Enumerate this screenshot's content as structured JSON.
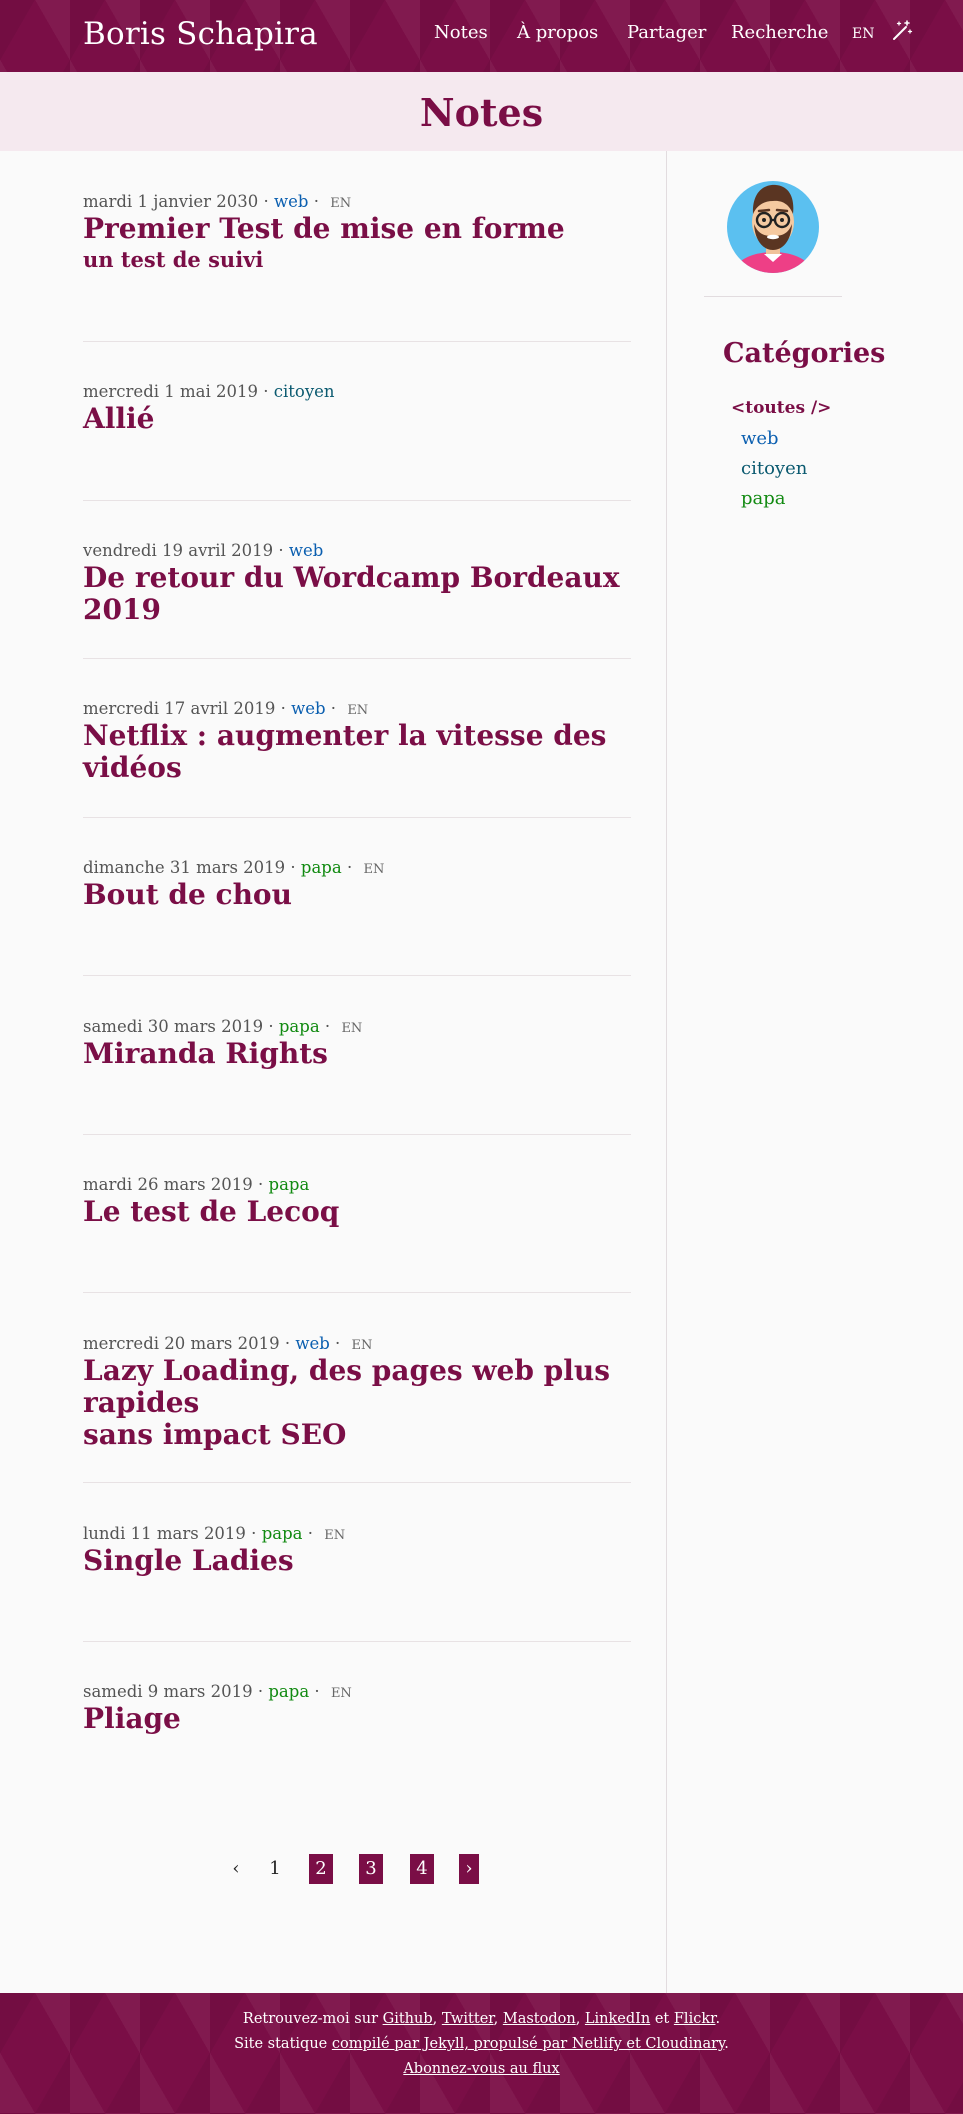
{
  "header": {
    "site_title": "Boris Schapira",
    "nav": [
      "Notes",
      "À propos",
      "Partager",
      "Recherche"
    ],
    "lang_switch": "EN",
    "theme_icon": "magic-wand-icon"
  },
  "page": {
    "title": "Notes"
  },
  "posts": [
    {
      "date": "mardi 1 janvier 2030",
      "category": "web",
      "lang": "EN",
      "title": "Premier Test de mise en forme",
      "subtitle": "un test de suivi"
    },
    {
      "date": "mercredi 1 mai 2019",
      "category": "citoyen",
      "lang": "",
      "title": "Allié"
    },
    {
      "date": "vendredi 19 avril 2019",
      "category": "web",
      "lang": "",
      "title": "De retour du Wordcamp Bordeaux 2019"
    },
    {
      "date": "mercredi 17 avril 2019",
      "category": "web",
      "lang": "EN",
      "title": "Netflix : augmenter la vitesse des vidéos"
    },
    {
      "date": "dimanche 31 mars 2019",
      "category": "papa",
      "lang": "EN",
      "title": "Bout de chou"
    },
    {
      "date": "samedi 30 mars 2019",
      "category": "papa",
      "lang": "EN",
      "title": "Miranda Rights"
    },
    {
      "date": "mardi 26 mars 2019",
      "category": "papa",
      "lang": "",
      "title": "Le test de Lecoq"
    },
    {
      "date": "mercredi 20 mars 2019",
      "category": "web",
      "lang": "EN",
      "title": "Lazy Loading, des pages web plus rapides",
      "title_line2": "sans impact SEO"
    },
    {
      "date": "lundi 11 mars 2019",
      "category": "papa",
      "lang": "EN",
      "title": "Single Ladies"
    },
    {
      "date": "samedi 9 mars 2019",
      "category": "papa",
      "lang": "EN",
      "title": "Pliage"
    }
  ],
  "sidebar": {
    "categories_heading": "Catégories",
    "all_label": "<toutes />",
    "categories": [
      "web",
      "citoyen",
      "papa"
    ]
  },
  "pagination": {
    "prev": "‹",
    "pages": [
      "1",
      "2",
      "3",
      "4"
    ],
    "next": "›"
  },
  "footer": {
    "line1_prefix": "Retrouvez-moi sur",
    "links": [
      "Github",
      "Twitter",
      "Mastodon",
      "LinkedIn",
      "Flickr"
    ],
    "line1_and": "et",
    "line2_prefix": "Site statique",
    "line2_link": "compilé par Jekyll, propulsé par Netlify et Cloudinary",
    "feed_link": "Abonnez-vous au flux"
  },
  "colors": {
    "brand": "#7a0e46",
    "web": "#0b5fb0",
    "citoyen": "#0b5a70",
    "papa": "#118a11"
  }
}
